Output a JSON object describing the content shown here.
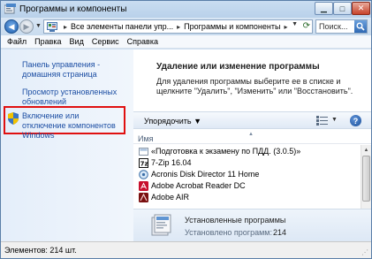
{
  "window": {
    "title": "Программы и компоненты"
  },
  "addressbar": {
    "segment_1": "Все элементы панели упр...",
    "segment_2": "Программы и компоненты",
    "search_placeholder": "Поиск...",
    "separator": "▸"
  },
  "menu": {
    "items": [
      "Файл",
      "Правка",
      "Вид",
      "Сервис",
      "Справка"
    ]
  },
  "leftpane": {
    "home_link": "Панель управления - домашняя страница",
    "updates_link": "Просмотр установленных обновлений",
    "features_link": "Включение или отключение компонентов Windows"
  },
  "main": {
    "title": "Удаление или изменение программы",
    "description": "Для удаления программы выберите ее в списке и щелкните \"Удалить\", \"Изменить\" или \"Восстановить\"."
  },
  "toolbar": {
    "organize_label": "Упорядочить",
    "help_symbol": "?"
  },
  "list": {
    "column_name": "Имя",
    "rows": [
      "«Подготовка к экзамену по ПДД. (3.0.5)»",
      "7-Zip 16.04",
      "Acronis Disk Director 11 Home",
      "Adobe Acrobat Reader DC",
      "Adobe AIR"
    ]
  },
  "details": {
    "title": "Установленные программы",
    "count_label": "Установлено программ:",
    "count_value": "214"
  },
  "status": {
    "text": "Элементов: 214 шт."
  },
  "colors": {
    "link": "#1c4ea3",
    "highlight_border": "#e01010",
    "frame": "#cfe0f2"
  }
}
